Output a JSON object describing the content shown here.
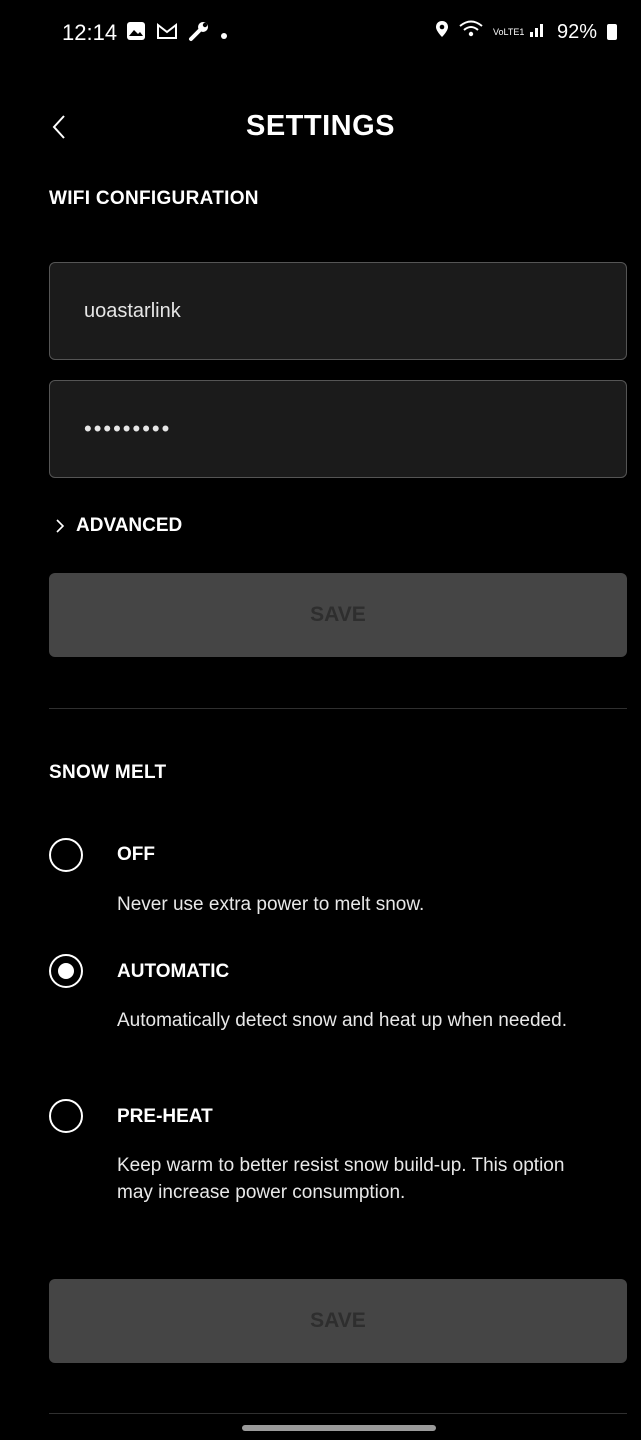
{
  "status_bar": {
    "time": "12:14",
    "left_icons": [
      "gallery-icon",
      "gmail-icon",
      "wrench-icon",
      "dot-icon"
    ],
    "battery": "92%",
    "right_icons": [
      "location-icon",
      "wifi-icon",
      "volte-icon",
      "signal-icon",
      "battery-icon"
    ],
    "volte_text": "VoLTE1"
  },
  "header": {
    "title": "SETTINGS"
  },
  "wifi": {
    "section_label": "WIFI CONFIGURATION",
    "ssid_value": "uoastarlink",
    "password_value": "•••••••••",
    "advanced_label": "ADVANCED",
    "save_label": "SAVE"
  },
  "snow_melt": {
    "section_label": "SNOW MELT",
    "options": [
      {
        "title": "OFF",
        "description": "Never use extra power to melt snow.",
        "selected": false
      },
      {
        "title": "AUTOMATIC",
        "description": "Automatically detect snow and heat up when needed.",
        "selected": true
      },
      {
        "title": "PRE-HEAT",
        "description": "Keep warm to better resist snow build-up. This option may increase power consumption.",
        "selected": false
      }
    ],
    "save_label": "SAVE"
  },
  "colors": {
    "background": "#000000",
    "text": "#ffffff",
    "field_bg": "#1b1b1b",
    "field_border": "#555555",
    "button_disabled": "#454545",
    "button_text_disabled": "#2e2e2e"
  }
}
